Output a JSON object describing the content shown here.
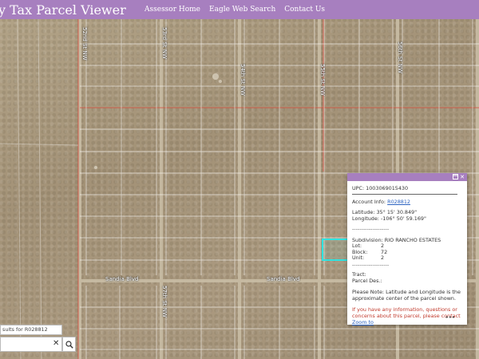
{
  "header": {
    "title": "y Tax Parcel Viewer",
    "nav": [
      "Assessor Home",
      "Eagle Web Search",
      "Contact Us"
    ]
  },
  "map": {
    "streets": {
      "st1": "52nd St NW",
      "st2": "53rd St NW",
      "st3": "54th St NW",
      "st4": "55th St NW",
      "st5": "56th St NW",
      "st6": "57th St NW",
      "blvd1": "Sandia Blvd",
      "blvd2": "Sandia Blvd"
    }
  },
  "popup": {
    "upc": "UPC: 1003069015430",
    "account_label": "Account Info: ",
    "account_link": "R028812",
    "latitude": "Latitude: 35° 15' 30.849\"",
    "longitude": "Longitude: -106° 50' 59.169\"",
    "dashes": "--------------------",
    "subdivision": "Subdivision: RIO RANCHO ESTATES",
    "lot_label": "Lot:",
    "lot_value": "2",
    "block_label": "Block:",
    "block_value": "72",
    "unit_label": "Unit:",
    "unit_value": "2",
    "dashes2": "--------------------",
    "tract": "Tract:",
    "parcel_des": "Parcel Des.:",
    "note": "Please Note: Latitude and Longitude is the approximate center of the parcel shown.",
    "contact_note": "If you have any information, questions or concerns about this parcel, please contact",
    "zoom_to": "Zoom to",
    "more": "•••"
  },
  "search": {
    "results_text": "sults for R028812",
    "input_value": ""
  },
  "colors": {
    "header": "#a77fbf",
    "highlight": "#2fe3e0",
    "link": "#2b62c0",
    "red_text": "#c0392b"
  }
}
